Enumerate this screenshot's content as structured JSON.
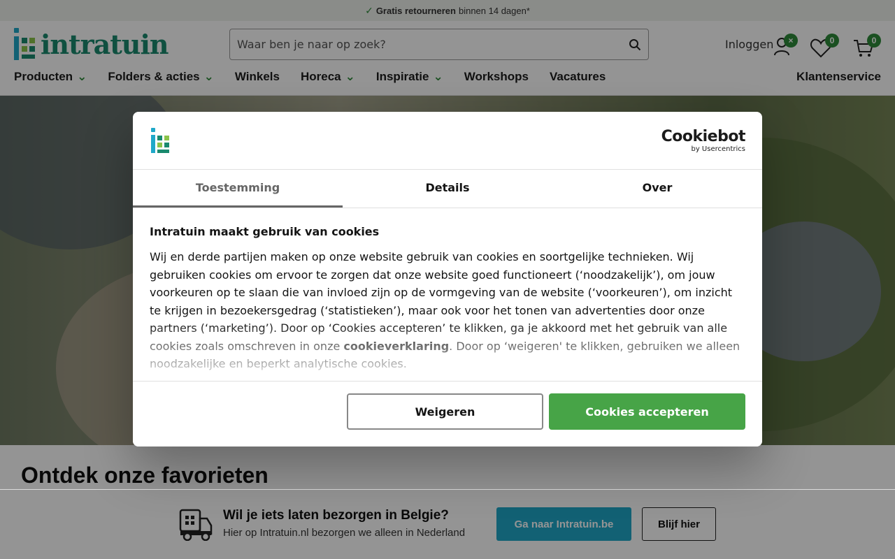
{
  "topbar": {
    "bold": "Gratis retourneren",
    "rest": "binnen 14 dagen*"
  },
  "header": {
    "logo_text": "intratuin",
    "search_placeholder": "Waar ben je naar op zoek?",
    "login_label": "Inloggen",
    "account_badge": "×",
    "wishlist_count": "0",
    "cart_count": "0",
    "nav": [
      "Producten",
      "Folders & acties",
      "Winkels",
      "Horeca",
      "Inspiratie",
      "Workshops",
      "Vacatures"
    ],
    "nav_right": "Klantenservice"
  },
  "section_title": "Ontdek onze favorieten",
  "cookie_dialog": {
    "brand_name": "Cookiebot",
    "brand_by": "by Usercentrics",
    "tabs": [
      "Toestemming",
      "Details",
      "Over"
    ],
    "active_tab": "Toestemming",
    "heading": "Intratuin maakt gebruik van cookies",
    "body_before_link": "Wij en derde partijen maken op onze website gebruik van cookies en soortgelijke technieken. Wij gebruiken cookies om ervoor te zorgen dat onze website goed functioneert (‘noodzakelijk’), om jouw voorkeuren op te slaan die van invloed zijn op de vormgeving van de website (‘voorkeuren’), om inzicht te krijgen in bezoekersgedrag (‘statistieken’), maar ook voor het tonen van advertenties door onze partners (‘marketing’). Door op ‘Cookies accepteren’ te klikken, ga je akkoord met het gebruik van alle cookies zoals omschreven in onze",
    "link_text": "cookieverklaring",
    "body_after_link": ". Door op ‘weigeren' te klikken, gebruiken we alleen noodzakelijke en beperkt analytische cookies.",
    "refuse_label": "Weigeren",
    "accept_label": "Cookies accepteren"
  },
  "belgium_banner": {
    "title": "Wil je iets laten bezorgen in Belgie?",
    "subtitle": "Hier op Intratuin.nl bezorgen we alleen in Nederland",
    "go_label": "Ga naar Intratuin.be",
    "stay_label": "Blijf hier"
  },
  "colors": {
    "brand_green": "#2e8b3a",
    "accept_green": "#47a447",
    "be_blue": "#1fa8c9",
    "logo_teal": "#1a8a6e"
  }
}
